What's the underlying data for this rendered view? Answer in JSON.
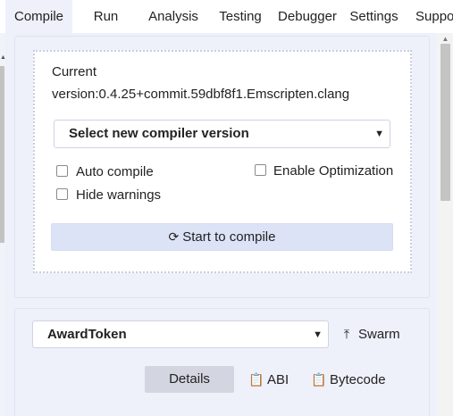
{
  "tabs": [
    {
      "label": "Compile",
      "active": true
    },
    {
      "label": "Run",
      "active": false
    },
    {
      "label": "Analysis",
      "active": false
    },
    {
      "label": "Testing",
      "active": false
    },
    {
      "label": "Debugger",
      "active": false
    },
    {
      "label": "Settings",
      "active": false
    },
    {
      "label": "Suppo",
      "active": false
    }
  ],
  "compiler": {
    "current_label": "Current",
    "current_version": "version:0.4.25+commit.59dbf8f1.Emscripten.clang",
    "version_select": "Select new compiler version",
    "options": {
      "auto_compile": {
        "label": "Auto compile",
        "checked": false
      },
      "enable_optimization": {
        "label": "Enable Optimization",
        "checked": false
      },
      "hide_warnings": {
        "label": "Hide warnings",
        "checked": false
      }
    },
    "compile_button": "Start to compile",
    "compile_icon": "refresh-icon"
  },
  "contract": {
    "selected": "AwardToken",
    "swarm_label": "Swarm",
    "swarm_icon": "upload-icon",
    "details_label": "Details",
    "abi_label": "ABI",
    "bytecode_label": "Bytecode",
    "copy_icon": "clipboard-icon"
  },
  "colors": {
    "active_tab_bg": "#eef0fa",
    "compile_button_bg": "#dde3f7",
    "details_button_bg": "#d3d6e1",
    "panel_bg": "#eef0fa"
  }
}
